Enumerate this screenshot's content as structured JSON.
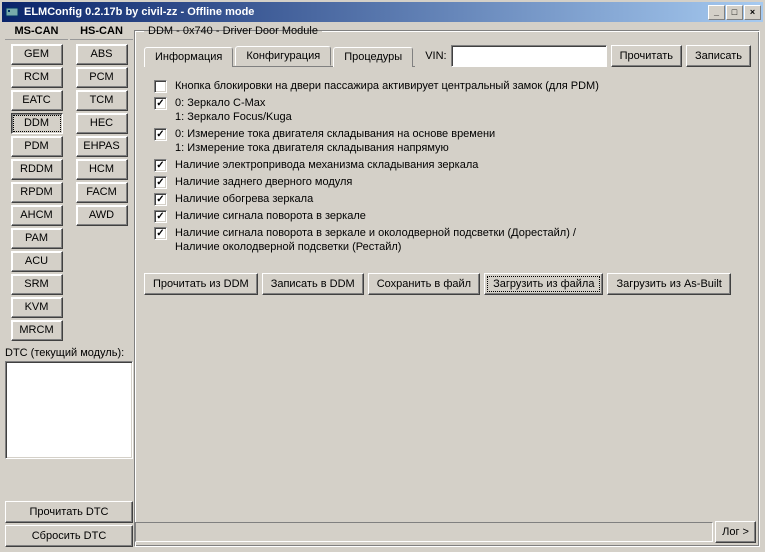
{
  "window": {
    "title": "ELMConfig 0.2.17b by civil-zz - Offline mode",
    "min_glyph": "_",
    "max_glyph": "□",
    "close_glyph": "×"
  },
  "bus": {
    "mscan_header": "MS-CAN",
    "hscan_header": "HS-CAN",
    "mscan": [
      "GEM",
      "RCM",
      "EATC",
      "DDM",
      "PDM",
      "RDDM",
      "RPDM",
      "AHCM",
      "PAM",
      "ACU",
      "SRM",
      "KVM",
      "MRCM"
    ],
    "hscan": [
      "ABS",
      "PCM",
      "TCM",
      "HEC",
      "EHPAS",
      "HCM",
      "FACM",
      "AWD"
    ],
    "active": "DDM"
  },
  "dtc": {
    "label": "DTC (текущий модуль):",
    "read": "Прочитать DTC",
    "clear": "Сбросить DTC"
  },
  "group": {
    "legend": "DDM - 0x740 - Driver Door Module"
  },
  "tabs": {
    "info": "Информация",
    "config": "Конфигурация",
    "proc": "Процедуры",
    "active": "config"
  },
  "vin": {
    "label": "VIN:",
    "value": "",
    "read": "Прочитать",
    "write": "Записать"
  },
  "options": [
    {
      "checked": false,
      "label": "Кнопка блокировки на двери пассажира активирует центральный замок (для PDM)"
    },
    {
      "checked": true,
      "label": "0: Зеркало C-Max\n1: Зеркало Focus/Kuga"
    },
    {
      "checked": true,
      "label": "0: Измерение тока двигателя складывания на основе времени\n1: Измерение тока двигателя складывания напрямую"
    },
    {
      "checked": true,
      "label": "Наличие электропривода механизма складывания зеркала"
    },
    {
      "checked": true,
      "label": "Наличие заднего дверного модуля"
    },
    {
      "checked": true,
      "label": "Наличие обогрева зеркала"
    },
    {
      "checked": true,
      "label": "Наличие сигнала поворота в зеркале"
    },
    {
      "checked": true,
      "label": "Наличие сигнала поворота в зеркале и околодверной подсветки (Дорестайл) /\nНаличие околодверной подсветки (Рестайл)"
    }
  ],
  "actions": {
    "read_module": "Прочитать из DDM",
    "write_module": "Записать в DDM",
    "save_file": "Сохранить в файл",
    "load_file": "Загрузить из файла",
    "load_asbuilt": "Загрузить из As-Built"
  },
  "footer": {
    "log": "Лог >"
  }
}
